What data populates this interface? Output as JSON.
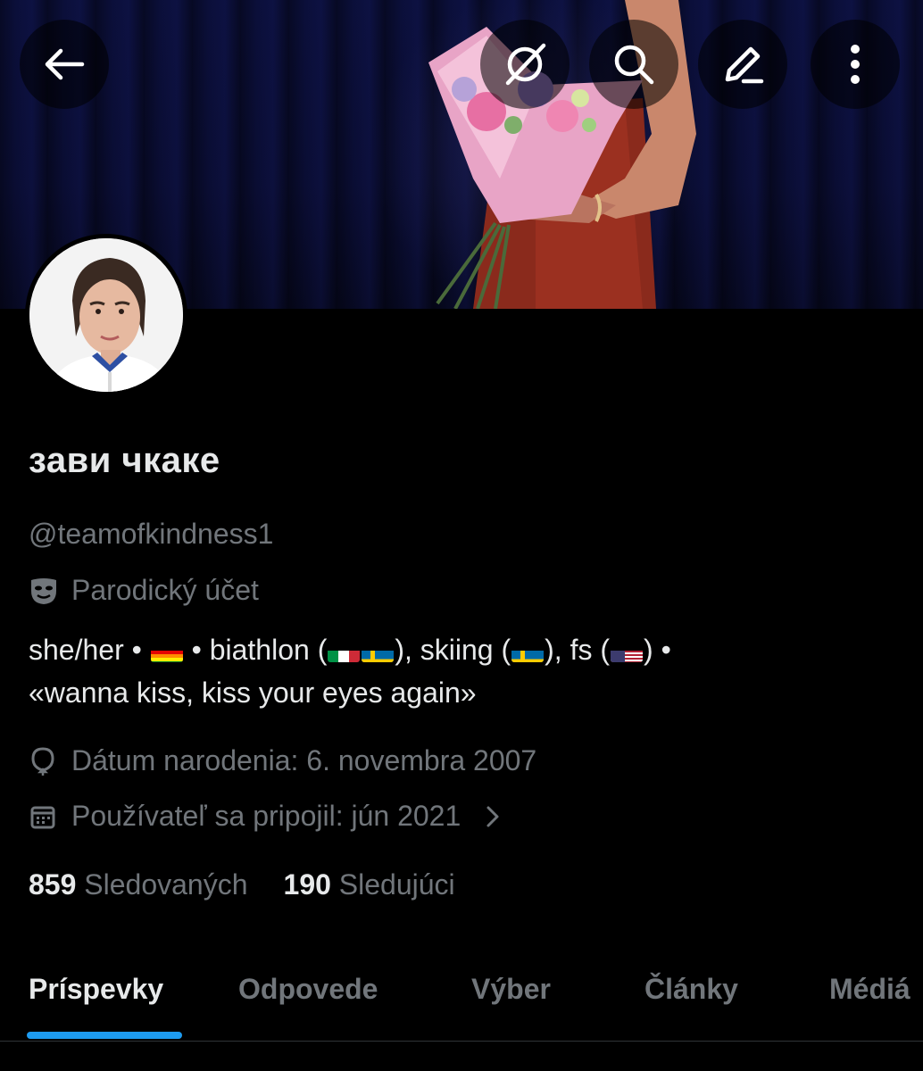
{
  "profile": {
    "display_name": "зави чкаке",
    "handle": "@teamofkindness1",
    "parody_label": "Parodický účet",
    "bio_line1_a": "she/her • ",
    "bio_line1_b": " • biathlon (",
    "bio_line1_c": "), skiing (",
    "bio_line1_d": "), fs (",
    "bio_line1_e": ") •",
    "bio_line2": "«wanna kiss, kiss your eyes again»",
    "birthday": "Dátum narodenia: 6. novembra 2007",
    "joined": "Používateľ sa pripojil: jún 2021",
    "following_count": "859",
    "following_label": "Sledovaných",
    "followers_count": "190",
    "followers_label": "Sledujúci"
  },
  "tabs": [
    {
      "label": "Príspevky",
      "active": true
    },
    {
      "label": "Odpovede",
      "active": false
    },
    {
      "label": "Výber",
      "active": false
    },
    {
      "label": "Články",
      "active": false
    },
    {
      "label": "Médiá",
      "active": false
    }
  ],
  "icons": {
    "back": "arrow-left-icon",
    "grok": "grok-icon",
    "search": "search-icon",
    "edit": "pencil-icon",
    "more": "more-vertical-icon",
    "parody": "mask-icon",
    "birthday": "balloon-icon",
    "calendar": "calendar-icon",
    "chevron": "chevron-right-icon"
  },
  "colors": {
    "accent": "#1d9bf0",
    "text": "#e7e9ea",
    "muted": "#71767b",
    "background": "#000000"
  }
}
